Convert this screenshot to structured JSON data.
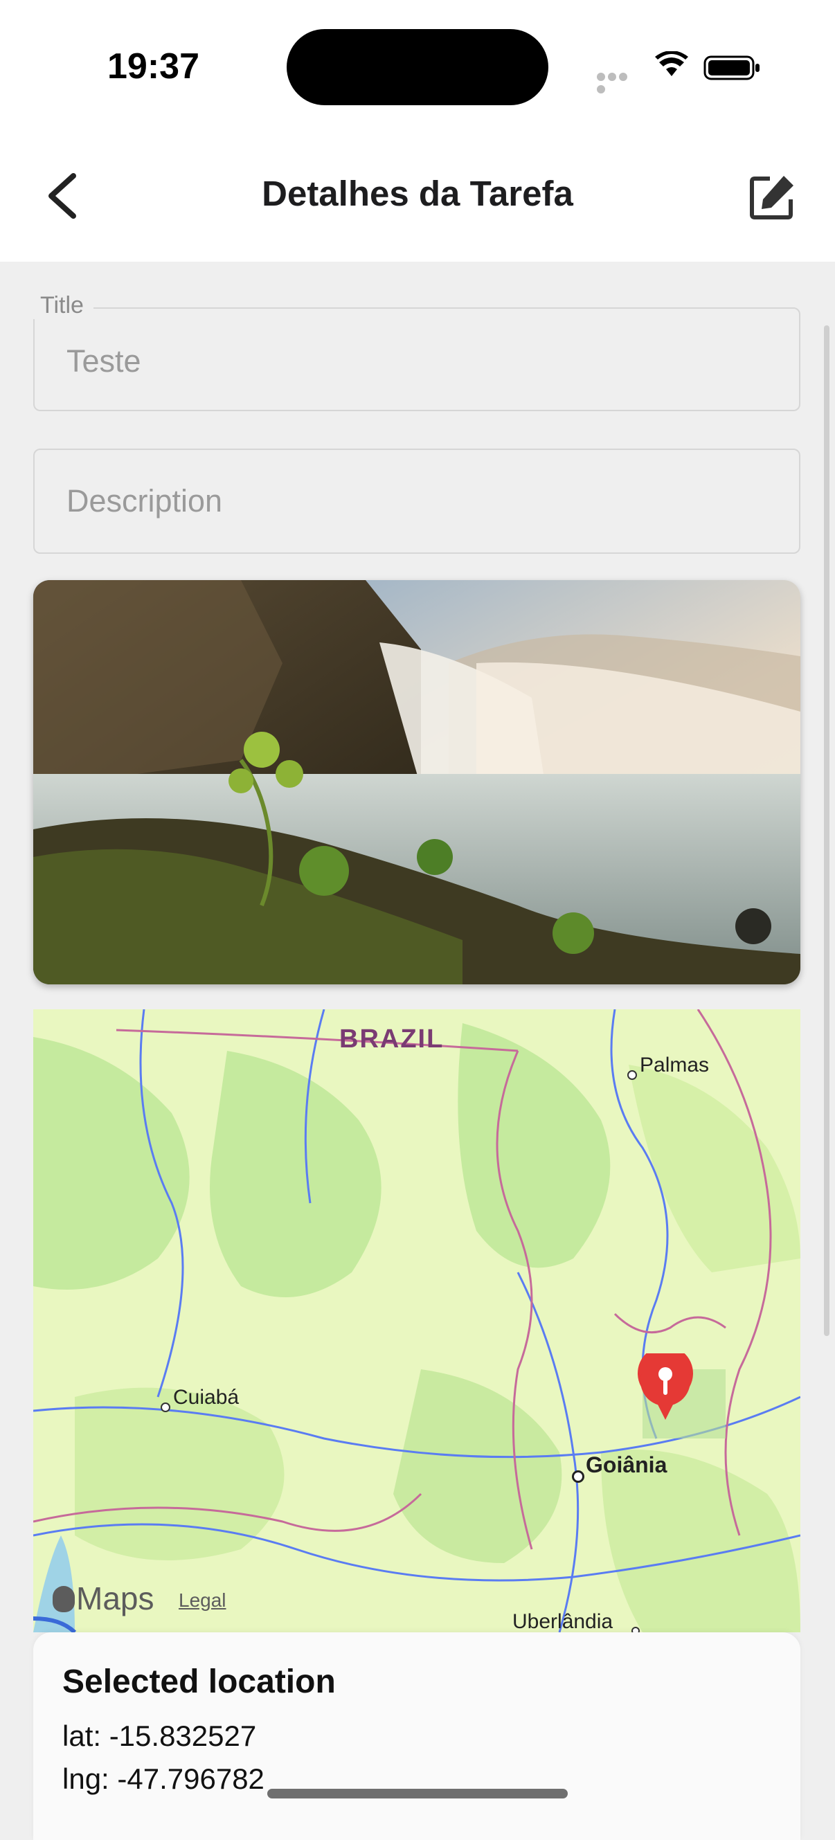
{
  "status_bar": {
    "time": "19:37"
  },
  "header": {
    "title": "Detalhes da Tarefa",
    "back_icon": "chevron-left-icon",
    "edit_icon": "edit-icon"
  },
  "form": {
    "title_label": "Title",
    "title_value": "Teste",
    "description_placeholder": "Description"
  },
  "photo": {
    "subject": "waterfall-landscape"
  },
  "map": {
    "country_label": "BRAZIL",
    "cities": [
      "Palmas",
      "Cuiabá",
      "Goiânia",
      "Uberlândia"
    ],
    "maps_label": "Maps",
    "legal_label": "Legal"
  },
  "location": {
    "heading": "Selected location",
    "lat": "lat: -15.832527",
    "lng": "lng: -47.796782"
  },
  "colors": {
    "background": "#efefef",
    "map_land": "#e9f7c0",
    "map_forest": "#c5ea9e",
    "pin": "#e53935",
    "river": "#5a7cf2",
    "border": "#c66a9a"
  }
}
